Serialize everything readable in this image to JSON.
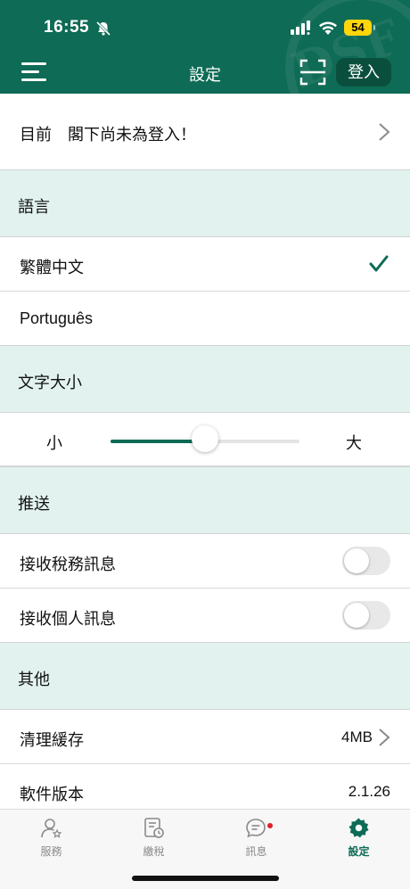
{
  "status_bar": {
    "time": "16:55",
    "battery": "54"
  },
  "header": {
    "title": "設定",
    "login_label": "登入",
    "watermark": "DSF"
  },
  "account": {
    "message": "目前　閣下尚未為登入！"
  },
  "language": {
    "section_title": "語言",
    "options": [
      {
        "label": "繁體中文",
        "selected": true
      },
      {
        "label": "Português",
        "selected": false
      }
    ]
  },
  "font_size": {
    "section_title": "文字大小",
    "min_label": "小",
    "max_label": "大",
    "level": 0.5
  },
  "push": {
    "section_title": "推送",
    "items": [
      {
        "label": "接收稅務訊息",
        "enabled": false
      },
      {
        "label": "接收個人訊息",
        "enabled": false
      }
    ]
  },
  "other": {
    "section_title": "其他",
    "clear_cache": {
      "label": "清理緩存",
      "value": "4MB"
    },
    "version": {
      "label": "軟件版本",
      "value": "2.1.26"
    }
  },
  "tabbar": {
    "tabs": [
      {
        "label": "服務",
        "icon": "user-star-icon",
        "active": false
      },
      {
        "label": "繳稅",
        "icon": "tax-document-icon",
        "active": false
      },
      {
        "label": "訊息",
        "icon": "message-icon",
        "active": false,
        "badge": true
      },
      {
        "label": "設定",
        "icon": "gear-icon",
        "active": true
      }
    ]
  },
  "colors": {
    "brand": "#0e6b55",
    "section_bg": "#e2f3ef",
    "badge": "#e0202a",
    "battery": "#ffd60a"
  }
}
